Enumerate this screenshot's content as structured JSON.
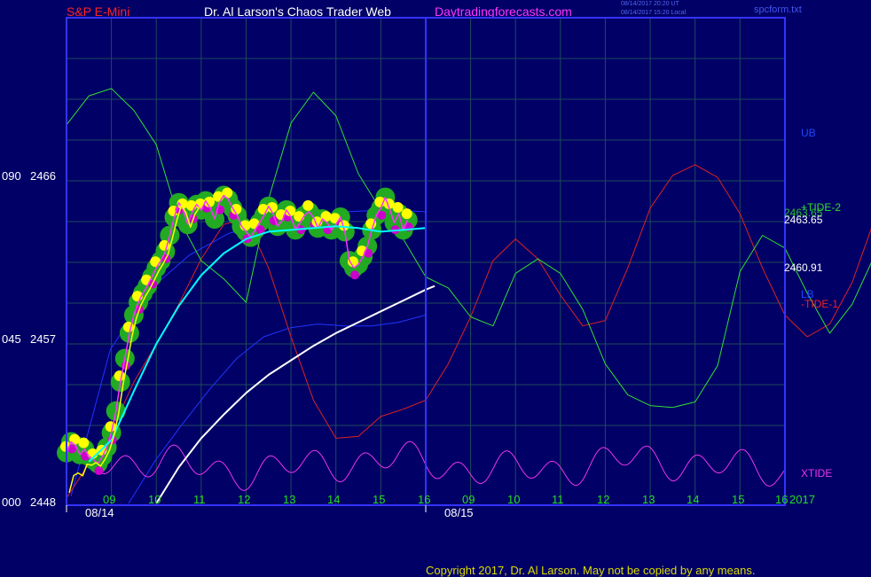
{
  "header": {
    "symbol": "S&P E-Mini",
    "title": "Dr. Al Larson's Chaos Trader Web",
    "site": "Daytradingforecasts.com",
    "stamp_ut": "08/14/2017 20:20 UT",
    "stamp_local": "08/14/2017 15:20 Local",
    "file": "spcform.txt"
  },
  "copyright": "Copyright 2017, Dr. Al Larson. May not be copied by any means.",
  "colors": {
    "background": "#000066",
    "grid": "#1f4a5a",
    "frame": "#3333ff",
    "price": "#ff33ff",
    "tide1": "#dd2222",
    "tide2": "#33dd33",
    "xtide": "#ee33ee",
    "bands": "#2233ff",
    "avg_fast": "#00ffff",
    "avg_slow": "#ffffff",
    "trend": "#ffff00",
    "electric_glow": "#22aa22",
    "electric_yellow": "#ffff00",
    "electric_magenta": "#cc00cc"
  },
  "chart_data": {
    "type": "line",
    "y_axis_labels": [
      {
        "left": "090",
        "price": "2466",
        "value": 2466
      },
      {
        "left": "045",
        "price": "2457",
        "value": 2457
      },
      {
        "left": "000",
        "price": "2448",
        "value": 2448
      }
    ],
    "ylim": [
      2448,
      2466
    ],
    "x_axis_labels": [
      "09",
      "10",
      "11",
      "12",
      "13",
      "14",
      "15",
      "16",
      "09",
      "10",
      "11",
      "12",
      "13",
      "14",
      "15",
      "16"
    ],
    "year_label": "2017",
    "date_labels": [
      "08/14",
      "08/15"
    ],
    "right_labels": {
      "ub": "UB",
      "lb": "LB",
      "tide2": "+TIDE-2",
      "tide1": "-TIDE-1",
      "xtide": "XTIDE",
      "last_price": "2463.65",
      "slow_avg_value": "2460.91",
      "tide2_overlap": "2463.65"
    },
    "price_series": {
      "name": "",
      "start_hour": 8.0,
      "step_hours": 0.1,
      "values": [
        2450.8,
        2451.4,
        2451.2,
        2450.7,
        2451.0,
        2450.6,
        2450.4,
        2450.2,
        2450.6,
        2451.1,
        2451.9,
        2453.1,
        2454.7,
        2456.0,
        2457.4,
        2458.4,
        2459.1,
        2459.6,
        2460.0,
        2460.5,
        2461.0,
        2461.4,
        2461.9,
        2462.8,
        2463.8,
        2464.6,
        2464.2,
        2463.4,
        2464.1,
        2464.5,
        2464.2,
        2464.7,
        2464.3,
        2463.7,
        2464.6,
        2465.0,
        2464.8,
        2464.3,
        2463.9,
        2463.3,
        2463.0,
        2462.7,
        2463.1,
        2463.5,
        2463.9,
        2464.4,
        2464.0,
        2463.3,
        2463.6,
        2464.2,
        2463.8,
        2463.1,
        2463.5,
        2463.9,
        2464.1,
        2463.8,
        2463.2,
        2463.7,
        2463.5,
        2463.1,
        2463.4,
        2463.8,
        2463.0,
        2461.4,
        2461.0,
        2461.2,
        2461.6,
        2462.2,
        2463.1,
        2463.9,
        2464.3,
        2464.9,
        2464.2,
        2463.5,
        2464.0,
        2463.1,
        2463.65
      ]
    },
    "bands": {
      "ub": [
        [
          2448.0,
          2448.4
        ],
        [
          2450.0,
          2456.5
        ],
        [
          2452.0,
          2459.8
        ],
        [
          2454.0,
          2461.7
        ],
        [
          2456.0,
          2462.9
        ],
        [
          2458.0,
          2463.5
        ],
        [
          2460.0,
          2463.9
        ],
        [
          2462.0,
          2464.1
        ],
        [
          2464.0,
          2464.2
        ],
        [
          2466.0,
          2464.1
        ]
      ],
      "lb": [
        [
          2455.0,
          2448.0
        ],
        [
          2457.0,
          2450.4
        ],
        [
          2459.0,
          2452.4
        ],
        [
          2461.0,
          2454.3
        ],
        [
          2463.0,
          2456.0
        ],
        [
          2465.0,
          2457.2
        ],
        [
          2467.0,
          2457.7
        ],
        [
          2469.0,
          2457.9
        ],
        [
          2471.0,
          2457.8
        ],
        [
          2473.0,
          2457.8
        ],
        [
          2475.0,
          2458.0
        ],
        [
          2477.0,
          2458.4
        ]
      ]
    },
    "cyan_average": [
      [
        8.5,
        2450.3
      ],
      [
        9.0,
        2451.5
      ],
      [
        9.5,
        2454.2
      ],
      [
        10.0,
        2456.8
      ],
      [
        10.5,
        2458.9
      ],
      [
        11.0,
        2460.6
      ],
      [
        11.5,
        2461.8
      ],
      [
        12.0,
        2462.6
      ],
      [
        12.5,
        2463.0
      ],
      [
        13.0,
        2463.1
      ],
      [
        13.5,
        2463.2
      ],
      [
        14.0,
        2463.3
      ],
      [
        14.5,
        2463.2
      ],
      [
        15.0,
        2463.0
      ],
      [
        15.5,
        2463.1
      ],
      [
        16.0,
        2463.2
      ]
    ],
    "white_average": [
      [
        10.0,
        2448.0
      ],
      [
        10.5,
        2450.0
      ],
      [
        11.0,
        2451.6
      ],
      [
        11.5,
        2452.9
      ],
      [
        12.0,
        2454.1
      ],
      [
        12.5,
        2455.1
      ],
      [
        13.0,
        2455.9
      ],
      [
        13.5,
        2456.7
      ],
      [
        14.0,
        2457.4
      ],
      [
        14.5,
        2458.0
      ],
      [
        15.0,
        2458.6
      ],
      [
        15.5,
        2459.2
      ],
      [
        16.0,
        2459.8
      ],
      [
        16.2,
        2460.0
      ]
    ],
    "tide1": [
      [
        8.0,
        2448.3
      ],
      [
        8.5,
        2450.2
      ],
      [
        9.0,
        2452.0
      ],
      [
        9.5,
        2454.7
      ],
      [
        10.0,
        2456.8
      ],
      [
        10.5,
        2459.0
      ],
      [
        11.0,
        2461.5
      ],
      [
        11.5,
        2463.4
      ],
      [
        12.0,
        2463.7
      ],
      [
        12.5,
        2461.0
      ],
      [
        13.0,
        2457.2
      ],
      [
        13.5,
        2453.7
      ],
      [
        14.0,
        2451.6
      ],
      [
        14.5,
        2451.7
      ],
      [
        15.0,
        2452.8
      ],
      [
        15.5,
        2453.2
      ],
      [
        16.0,
        2453.7
      ],
      [
        16.5,
        2455.7
      ],
      [
        17.0,
        2458.3
      ],
      [
        17.5,
        2461.4
      ],
      [
        18.0,
        2462.6
      ],
      [
        18.5,
        2461.5
      ],
      [
        19.0,
        2459.5
      ],
      [
        19.5,
        2457.8
      ],
      [
        20.0,
        2458.1
      ],
      [
        20.5,
        2461.0
      ],
      [
        21.0,
        2464.3
      ],
      [
        21.5,
        2466.1
      ],
      [
        22.0,
        2466.7
      ],
      [
        22.5,
        2466.0
      ],
      [
        23.0,
        2464.0
      ],
      [
        23.5,
        2461.0
      ],
      [
        24.0,
        2458.4
      ],
      [
        24.5,
        2457.2
      ],
      [
        25.0,
        2457.9
      ],
      [
        25.5,
        2460.2
      ],
      [
        26.0,
        2463.7
      ],
      [
        26.5,
        2465.4
      ],
      [
        27.0,
        2463.5
      ],
      [
        27.5,
        2461.0
      ],
      [
        28.0,
        2458.8
      ],
      [
        28.5,
        2457.3
      ],
      [
        29.0,
        2456.7
      ],
      [
        29.5,
        2456.9
      ],
      [
        30.0,
        2456.2
      ],
      [
        30.5,
        2455.6
      ],
      [
        31.0,
        2455.3
      ],
      [
        31.5,
        2456.2
      ]
    ],
    "tide2": [
      [
        8.0,
        2468.9
      ],
      [
        8.5,
        2470.5
      ],
      [
        9.0,
        2470.9
      ],
      [
        9.5,
        2469.7
      ],
      [
        10.0,
        2467.8
      ],
      [
        10.5,
        2463.7
      ],
      [
        11.0,
        2461.4
      ],
      [
        11.5,
        2460.4
      ],
      [
        12.0,
        2459.1
      ],
      [
        12.5,
        2464.8
      ],
      [
        13.0,
        2469.0
      ],
      [
        13.5,
        2470.7
      ],
      [
        14.0,
        2469.4
      ],
      [
        14.5,
        2466.2
      ],
      [
        15.0,
        2464.2
      ],
      [
        15.5,
        2462.6
      ],
      [
        16.0,
        2460.5
      ],
      [
        16.5,
        2459.9
      ],
      [
        17.0,
        2458.3
      ],
      [
        17.5,
        2457.8
      ],
      [
        18.0,
        2460.7
      ],
      [
        18.5,
        2461.5
      ],
      [
        19.0,
        2460.7
      ],
      [
        19.5,
        2458.7
      ],
      [
        20.0,
        2455.7
      ],
      [
        20.5,
        2454.0
      ],
      [
        21.0,
        2453.4
      ],
      [
        21.5,
        2453.3
      ],
      [
        22.0,
        2453.6
      ],
      [
        22.5,
        2455.6
      ],
      [
        23.0,
        2460.8
      ],
      [
        23.5,
        2462.8
      ],
      [
        24.0,
        2462.1
      ],
      [
        24.5,
        2459.6
      ],
      [
        25.0,
        2457.4
      ],
      [
        25.5,
        2459.0
      ],
      [
        26.0,
        2461.7
      ],
      [
        26.5,
        2464.4
      ],
      [
        27.0,
        2466.0
      ],
      [
        27.5,
        2464.4
      ],
      [
        28.0,
        2461.7
      ],
      [
        28.5,
        2458.9
      ],
      [
        29.0,
        2458.1
      ],
      [
        29.5,
        2458.8
      ],
      [
        30.0,
        2460.2
      ],
      [
        30.5,
        2462.6
      ],
      [
        31.0,
        2465.2
      ],
      [
        31.5,
        2465.3
      ]
    ]
  }
}
